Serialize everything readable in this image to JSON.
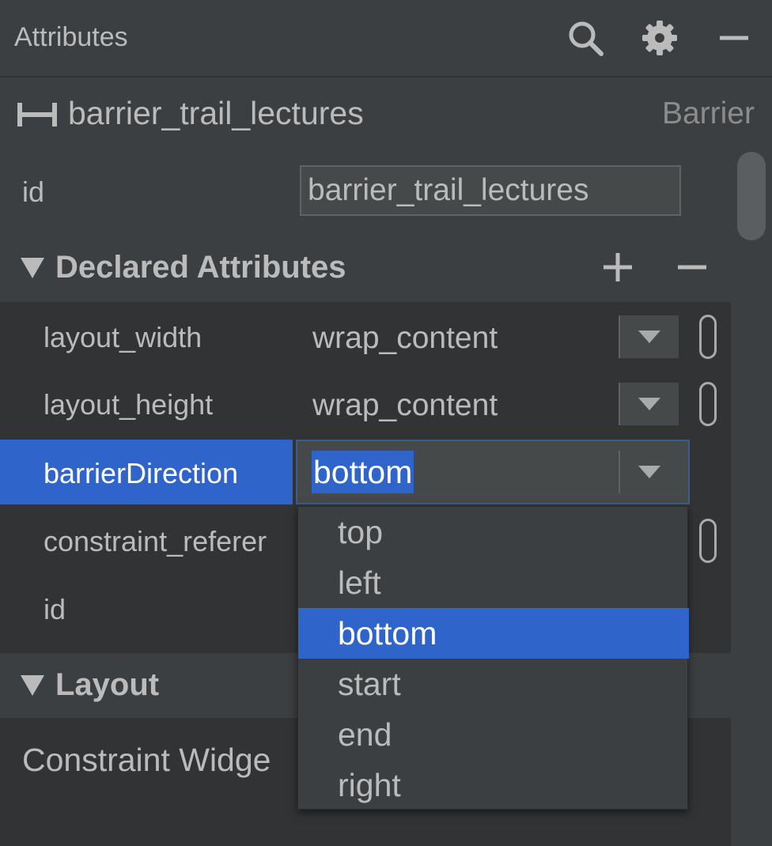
{
  "panel": {
    "title": "Attributes",
    "icons": [
      "search-icon",
      "gear-icon",
      "minimize-icon"
    ]
  },
  "component": {
    "icon": "barrier-icon",
    "name": "barrier_trail_lectures",
    "type": "Barrier"
  },
  "id_field": {
    "label": "id",
    "value": "barrier_trail_lectures"
  },
  "declared": {
    "title": "Declared Attributes",
    "add_icon": "plus-icon",
    "remove_icon": "minus-icon",
    "rows": [
      {
        "name": "layout_width",
        "value": "wrap_content"
      },
      {
        "name": "layout_height",
        "value": "wrap_content"
      },
      {
        "name": "barrierDirection",
        "value": "bottom"
      },
      {
        "name": "constraint_referer",
        "value": ""
      },
      {
        "name": "id",
        "value": ""
      }
    ]
  },
  "dropdown": {
    "options": [
      "top",
      "left",
      "bottom",
      "start",
      "end",
      "right"
    ],
    "selected": "bottom"
  },
  "layout": {
    "title": "Layout",
    "widget_label": "Constraint Widge"
  },
  "colors": {
    "background": "#3c3f41",
    "section_bg": "#313335",
    "accent": "#2f65ca",
    "text": "#bbbbbb"
  }
}
